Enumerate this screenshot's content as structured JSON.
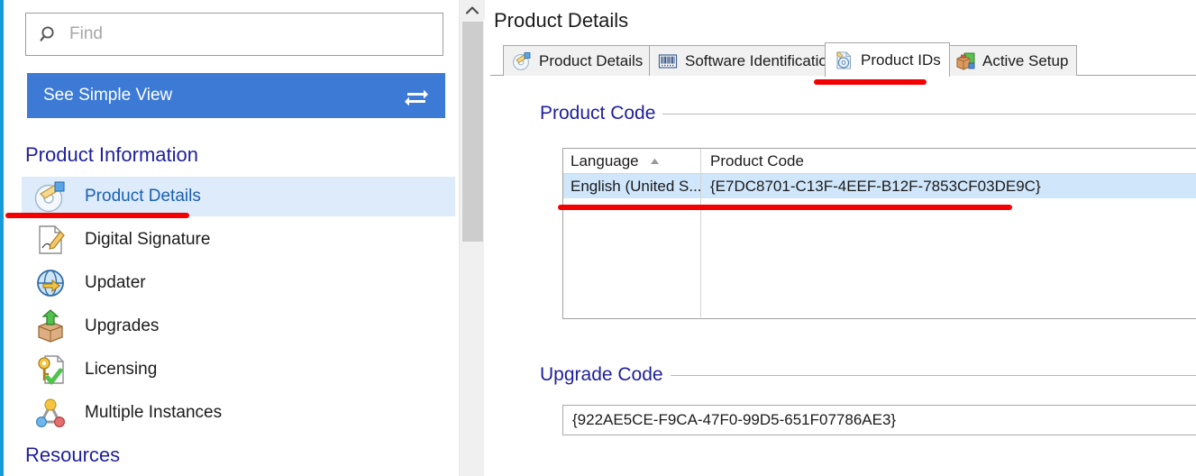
{
  "sidebar": {
    "search": {
      "icon": "search-icon",
      "placeholder": "Find",
      "value": ""
    },
    "simple_view": {
      "label": "See Simple View",
      "icon": "swap-arrows-icon",
      "accent": "#3c7ad6"
    },
    "groups": [
      {
        "title": "Product Information"
      },
      {
        "title": "Resources"
      }
    ],
    "items": [
      {
        "label": "Product Details",
        "icon": "disc-tag-icon",
        "selected": true
      },
      {
        "label": "Digital Signature",
        "icon": "signed-page-icon",
        "selected": false
      },
      {
        "label": "Updater",
        "icon": "globe-arrow-icon",
        "selected": false
      },
      {
        "label": "Upgrades",
        "icon": "box-up-arrow-icon",
        "selected": false
      },
      {
        "label": "Licensing",
        "icon": "key-check-icon",
        "selected": false
      },
      {
        "label": "Multiple Instances",
        "icon": "node-graph-icon",
        "selected": false
      }
    ]
  },
  "scrollbar": {
    "up_arrow_icon": "chevron-up-icon"
  },
  "main": {
    "title": "Product Details",
    "tabs": [
      {
        "label": "Product Details",
        "icon": "disc-tag-icon",
        "active": false
      },
      {
        "label": "Software Identification",
        "icon": "barcode-icon",
        "active": false
      },
      {
        "label": "Product IDs",
        "icon": "disc-page-icon",
        "active": true
      },
      {
        "label": "Active Setup",
        "icon": "package-box-icon",
        "active": false
      }
    ],
    "product_code_group": {
      "title": "Product Code",
      "columns": [
        "Language",
        "Product Code"
      ],
      "sort": {
        "column": "Language",
        "direction": "ascending",
        "icon": "sort-ascending-icon"
      },
      "rows": [
        {
          "language": "English (United S...",
          "product_code": "{E7DC8701-C13F-4EEF-B12F-7853CF03DE9C}",
          "selected": true
        }
      ]
    },
    "upgrade_code_group": {
      "title": "Upgrade Code",
      "value": "{922AE5CE-F9CA-47F0-99D5-651F07786AE3}"
    }
  },
  "annotations": {
    "color": "#f40000",
    "marks": [
      {
        "name": "underline-sidebar-product-details"
      },
      {
        "name": "underline-tab-product-ids"
      },
      {
        "name": "underline-product-code-row"
      }
    ]
  }
}
